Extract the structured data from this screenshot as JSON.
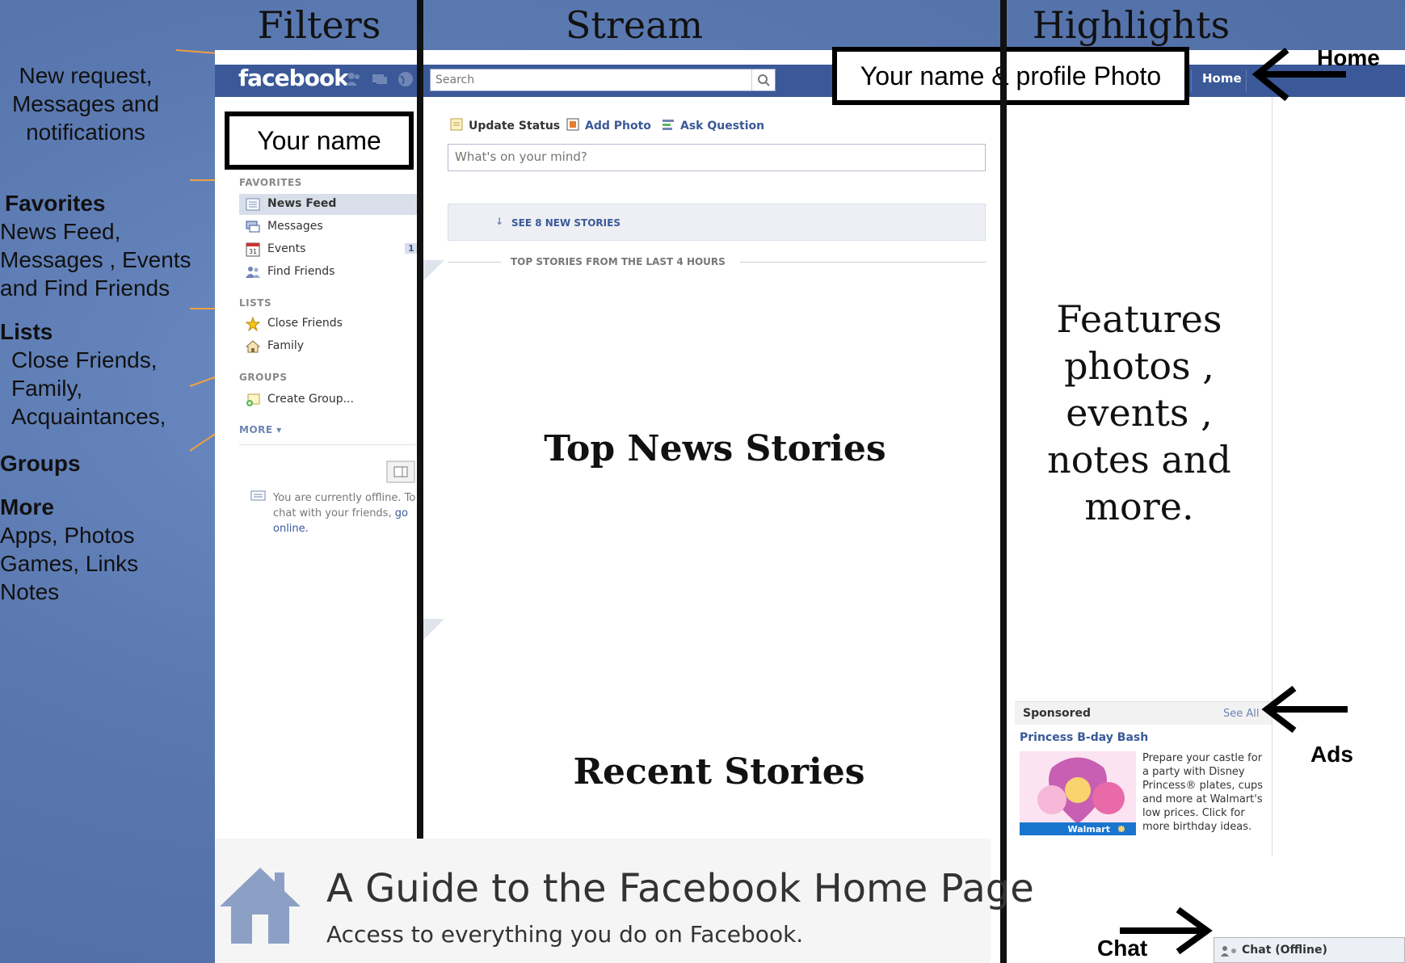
{
  "columns": {
    "filters": "Filters",
    "stream": "Stream",
    "highlights": "Highlights"
  },
  "left_notes": {
    "new_request": [
      "New request,",
      "Messages and",
      "notifications"
    ],
    "favorites_title": "Favorites",
    "favorites_items": [
      "News Feed,",
      "Messages , Events",
      "and Find Friends"
    ],
    "lists_title": "Lists",
    "lists_items": [
      "Close Friends,",
      "Family,",
      "Acquaintances,"
    ],
    "groups_title": "Groups",
    "more_title": "More",
    "more_items": [
      "Apps, Photos",
      "Games, Links",
      "Notes"
    ]
  },
  "fb": {
    "logo": "facebook",
    "search_placeholder": "Search",
    "home": "Home"
  },
  "callouts": {
    "your_name": "Your name",
    "your_name_photo": "Your name & profile Photo"
  },
  "nav": {
    "favorites_header": "FAVORITES",
    "favorites": [
      {
        "label": "News Feed",
        "icon": "news-feed-icon"
      },
      {
        "label": "Messages",
        "icon": "messages-icon"
      },
      {
        "label": "Events",
        "icon": "events-icon",
        "badge": "1"
      },
      {
        "label": "Find Friends",
        "icon": "find-friends-icon"
      }
    ],
    "events_icon_text": "31",
    "lists_header": "LISTS",
    "lists": [
      {
        "label": "Close Friends",
        "icon": "star-icon"
      },
      {
        "label": "Family",
        "icon": "house-icon"
      }
    ],
    "groups_header": "GROUPS",
    "groups": [
      {
        "label": "Create Group...",
        "icon": "create-group-icon"
      }
    ],
    "more": "MORE",
    "offline_1": "You are currently offline. To",
    "offline_2": "chat with your friends,",
    "offline_link_1": "go",
    "offline_link_2": "online."
  },
  "stream": {
    "update_status": "Update Status",
    "add_photo": "Add Photo",
    "ask_question": "Ask Question",
    "status_placeholder": "What's on your mind?",
    "see_new": "SEE 8 NEW STORIES",
    "top_stories": "TOP STORIES FROM THE LAST 4 HOURS",
    "top_news_label": "Top News Stories",
    "recent_label": "Recent Stories"
  },
  "highlights": {
    "features": [
      "Features",
      "photos ,",
      "events ,",
      "notes and",
      "more."
    ],
    "sponsored": "Sponsored",
    "see_all": "See All",
    "ad_title": "Princess B-day Bash",
    "ad_text": "Prepare your castle for a party with Disney Princess® plates, cups and more at Walmart's low prices. Click for more birthday ideas.",
    "ad_brand": "Walmart",
    "chat": "Chat (Offline)"
  },
  "annotations": {
    "home": "Home",
    "ads": "Ads",
    "chat": "Chat"
  },
  "guide": {
    "title": "A Guide to the Facebook Home Page",
    "subtitle": "Access to everything you do on Facebook."
  },
  "colors": {
    "fb_blue": "#3b5998",
    "background": "#5b7bb5",
    "annotation_arrow": "#f0a040"
  }
}
